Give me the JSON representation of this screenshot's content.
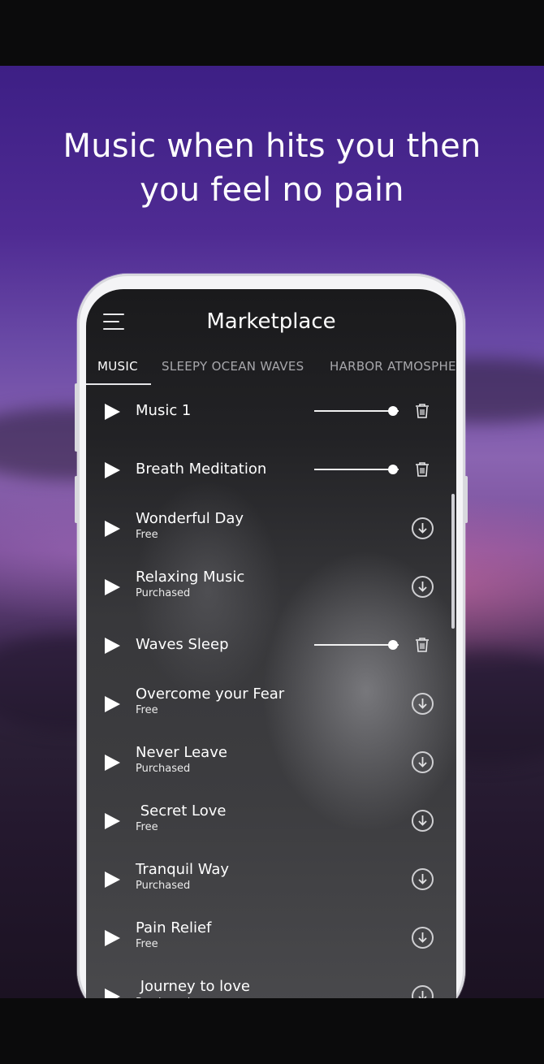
{
  "headline": "Music when hits you then you feel no pain",
  "app": {
    "title": "Marketplace"
  },
  "tabs": [
    {
      "label": "MUSIC",
      "active": true
    },
    {
      "label": "SLEEPY OCEAN WAVES",
      "active": false
    },
    {
      "label": "HARBOR ATMOSPHE",
      "active": false
    }
  ],
  "tracks": [
    {
      "title": "Music 1",
      "subtitle": "",
      "action": "slider-delete",
      "volume": 0.93
    },
    {
      "title": "Breath Meditation",
      "subtitle": "",
      "action": "slider-delete",
      "volume": 0.93
    },
    {
      "title": "Wonderful Day",
      "subtitle": "Free",
      "action": "download"
    },
    {
      "title": "Relaxing Music",
      "subtitle": "Purchased",
      "action": "download"
    },
    {
      "title": "Waves Sleep",
      "subtitle": "",
      "action": "slider-delete",
      "volume": 0.93
    },
    {
      "title": "Overcome your Fear",
      "subtitle": "Free",
      "action": "download"
    },
    {
      "title": "Never Leave",
      "subtitle": "Purchased",
      "action": "download"
    },
    {
      "title": " Secret Love",
      "subtitle": "Free",
      "action": "download"
    },
    {
      "title": "Tranquil Way",
      "subtitle": "Purchased",
      "action": "download"
    },
    {
      "title": "Pain Relief",
      "subtitle": "Free",
      "action": "download"
    },
    {
      "title": " Journey to love",
      "subtitle": "Purchased",
      "action": "download"
    }
  ],
  "icons": {
    "menu": "hamburger-menu-icon",
    "play": "play-icon",
    "delete": "trash-icon",
    "download": "download-icon"
  },
  "colors": {
    "text": "#ffffff",
    "tab_inactive": "#a7a7ab",
    "background_top": "#3d1f85",
    "screen": "#222225"
  }
}
